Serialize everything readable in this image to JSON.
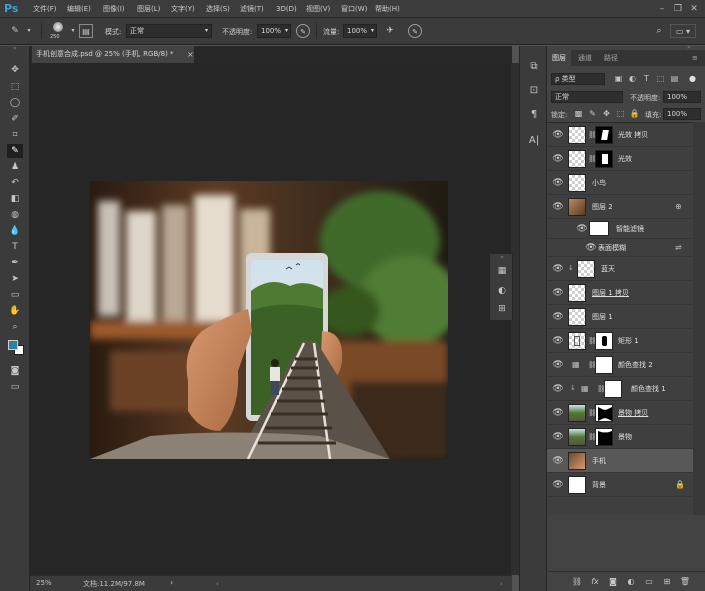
{
  "app": {
    "logo": "Ps"
  },
  "menu": [
    "文件(F)",
    "编辑(E)",
    "图像(I)",
    "图层(L)",
    "文字(Y)",
    "选择(S)",
    "滤镜(T)",
    "3D(D)",
    "视图(V)",
    "窗口(W)",
    "帮助(H)"
  ],
  "options": {
    "brush_size": "250",
    "mode_label": "模式:",
    "mode_value": "正常",
    "opacity_label": "不透明度:",
    "opacity_value": "100%",
    "flow_label": "流量:",
    "flow_value": "100%"
  },
  "document": {
    "tab_title": "手机创意合成.psd @ 25% (手机, RGB/8) *",
    "zoom": "25%",
    "doc_info": "文档:11.2M/97.8M"
  },
  "layers_panel": {
    "tabs": [
      "图层",
      "通道",
      "路径"
    ],
    "active_tab": "图层",
    "filter_kind": "ρ 类型",
    "blend_mode": "正常",
    "opacity_label": "不透明度:",
    "opacity_value": "100%",
    "lock_label": "锁定:",
    "fill_label": "填充:",
    "fill_value": "100%",
    "layers": [
      {
        "name": "光效 拷贝",
        "thumb": "checker",
        "mask": "white-shape"
      },
      {
        "name": "光效",
        "thumb": "checker",
        "mask": "white-shape"
      },
      {
        "name": "小鸟",
        "thumb": "checker-bird"
      },
      {
        "name": "图层 2",
        "thumb": "photo",
        "smart": true
      },
      {
        "name": "智能滤镜",
        "sub": true
      },
      {
        "name": "表面模糊",
        "sub": true
      },
      {
        "name": "蓝天",
        "thumb": "checker-sky",
        "clipped": true
      },
      {
        "name": "图层 1 拷贝",
        "thumb": "checker"
      },
      {
        "name": "图层 1",
        "thumb": "checker"
      },
      {
        "name": "矩形 1",
        "thumb": "checker-rect",
        "mask": "black-rect"
      },
      {
        "name": "颜色查找 2",
        "thumb": "adjust",
        "mask": "white"
      },
      {
        "name": "颜色查找 1",
        "thumb": "adjust",
        "mask": "white",
        "clipped": true
      },
      {
        "name": "景物 拷贝",
        "thumb": "photo-green",
        "mask": "black-shape"
      },
      {
        "name": "景物",
        "thumb": "photo-green",
        "mask": "black-shape"
      },
      {
        "name": "手机",
        "thumb": "photo-hand",
        "selected": true
      },
      {
        "name": "背景",
        "thumb": "white",
        "locked": true
      }
    ]
  },
  "colors": {
    "ps_blue": "#39a2db",
    "foreground": "#2e7fa0",
    "background": "#ffffff",
    "canvas": "#262626",
    "panel": "#434343"
  }
}
